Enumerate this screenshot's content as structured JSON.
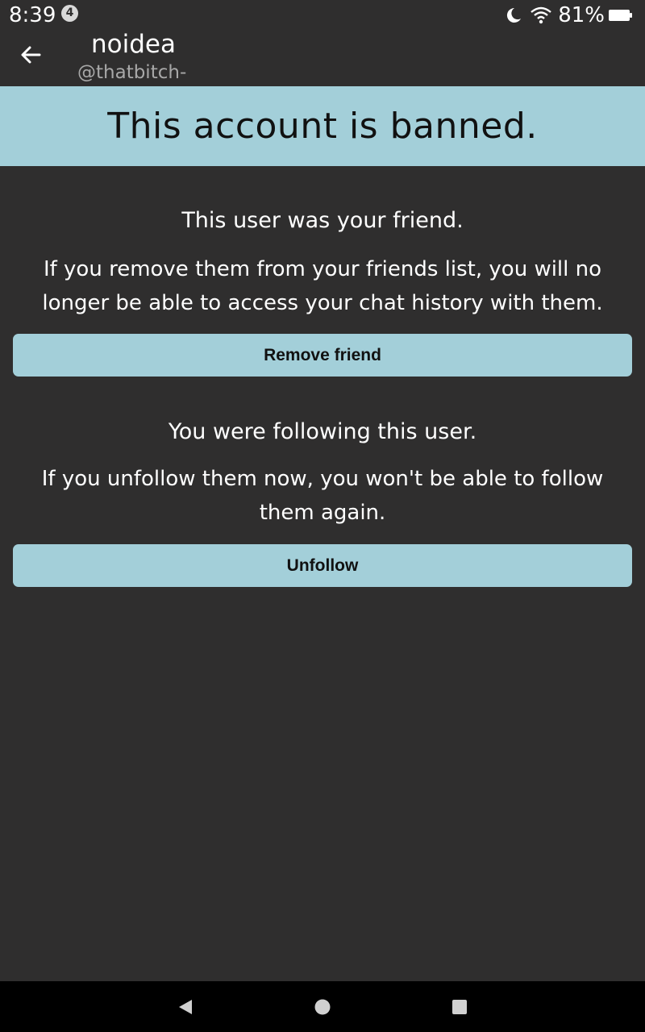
{
  "status_bar": {
    "time": "8:39",
    "notification_count": "4",
    "battery_percent": "81%",
    "icons": [
      "moon-icon",
      "wifi-icon",
      "battery-icon"
    ]
  },
  "header": {
    "back_icon": "arrow-left-icon",
    "title": "noidea",
    "subtitle": "@thatbitch-"
  },
  "banner": {
    "text": "This account is banned."
  },
  "friend_section": {
    "heading": "This user was your friend.",
    "text": "If you remove them from your friends list, you will no longer be able to access your chat history with them.",
    "button_label": "Remove friend"
  },
  "follow_section": {
    "heading": "You were following this user.",
    "text": "If you unfollow them now, you won't be able to follow them again.",
    "button_label": "Unfollow"
  },
  "nav_bar": {
    "icons": [
      "nav-back-icon",
      "nav-home-icon",
      "nav-recents-icon"
    ]
  },
  "colors": {
    "background": "#2f2e2e",
    "accent": "#a3cfd9",
    "nav_background": "#000000"
  }
}
